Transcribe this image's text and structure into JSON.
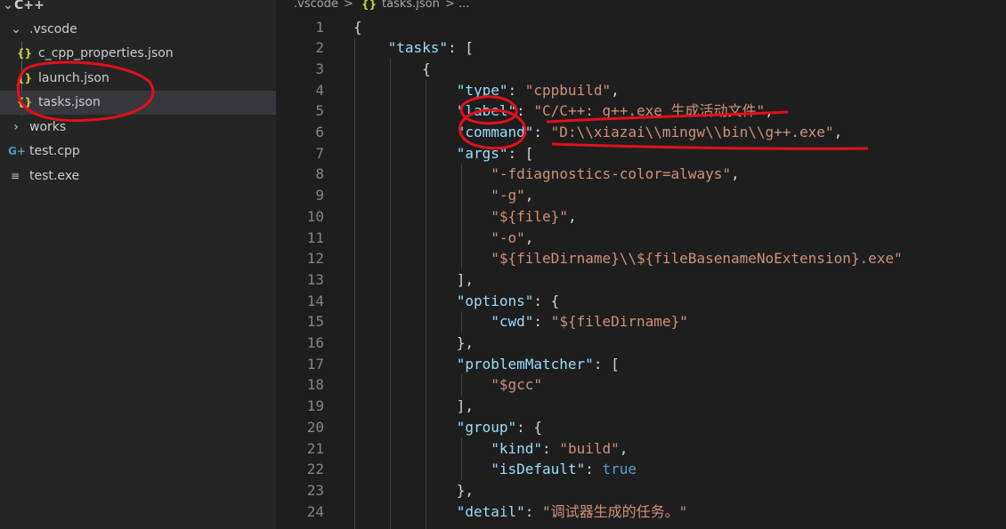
{
  "sidebar": {
    "root_label": "C++",
    "items": [
      {
        "label": ".vscode",
        "icon": "chevron-down",
        "level": 1
      },
      {
        "label": "c_cpp_properties.json",
        "icon": "json-braces",
        "level": 2
      },
      {
        "label": "launch.json",
        "icon": "json-braces",
        "level": 2
      },
      {
        "label": "tasks.json",
        "icon": "json-braces",
        "level": 2,
        "selected": true
      },
      {
        "label": "works",
        "icon": "chevron-right",
        "level": 1
      },
      {
        "label": "test.cpp",
        "icon": "cpp-file",
        "level": 1
      },
      {
        "label": "test.exe",
        "icon": "binary-file",
        "level": 1
      }
    ]
  },
  "breadcrumb": {
    "folder": ".vscode",
    "separator": ">",
    "file_icon": "{}",
    "file": "tasks.json",
    "ellipsis": "..."
  },
  "editor": {
    "lines": [
      {
        "n": "1",
        "text": "{"
      },
      {
        "n": "2",
        "text": "    \"tasks\": ["
      },
      {
        "n": "3",
        "text": "        {"
      },
      {
        "n": "4",
        "text": "            \"type\": \"cppbuild\","
      },
      {
        "n": "5",
        "text": "            \"label\": \"C/C++: g++.exe 生成活动文件\","
      },
      {
        "n": "6",
        "text": "            \"command\": \"D:\\\\xiazai\\\\mingw\\\\bin\\\\g++.exe\","
      },
      {
        "n": "7",
        "text": "            \"args\": ["
      },
      {
        "n": "8",
        "text": "                \"-fdiagnostics-color=always\","
      },
      {
        "n": "9",
        "text": "                \"-g\","
      },
      {
        "n": "10",
        "text": "                \"${file}\","
      },
      {
        "n": "11",
        "text": "                \"-o\","
      },
      {
        "n": "12",
        "text": "                \"${fileDirname}\\\\${fileBasenameNoExtension}.exe\""
      },
      {
        "n": "13",
        "text": "            ],"
      },
      {
        "n": "14",
        "text": "            \"options\": {"
      },
      {
        "n": "15",
        "text": "                \"cwd\": \"${fileDirname}\""
      },
      {
        "n": "16",
        "text": "            },"
      },
      {
        "n": "17",
        "text": "            \"problemMatcher\": ["
      },
      {
        "n": "18",
        "text": "                \"$gcc\""
      },
      {
        "n": "19",
        "text": "            ],"
      },
      {
        "n": "20",
        "text": "            \"group\": {"
      },
      {
        "n": "21",
        "text": "                \"kind\": \"build\","
      },
      {
        "n": "22",
        "text": "                \"isDefault\": true"
      },
      {
        "n": "23",
        "text": "            },"
      },
      {
        "n": "24",
        "text": "            \"detail\": \"调试器生成的任务。\""
      }
    ]
  },
  "colors": {
    "key": "#9cdcfe",
    "string": "#ce9178",
    "boolean": "#569cd6",
    "punctuation": "#d4d4d4",
    "line_number": "#858585",
    "annotation": "#e3101b",
    "json_icon": "#cbcb41",
    "cpp_icon": "#519aba"
  }
}
